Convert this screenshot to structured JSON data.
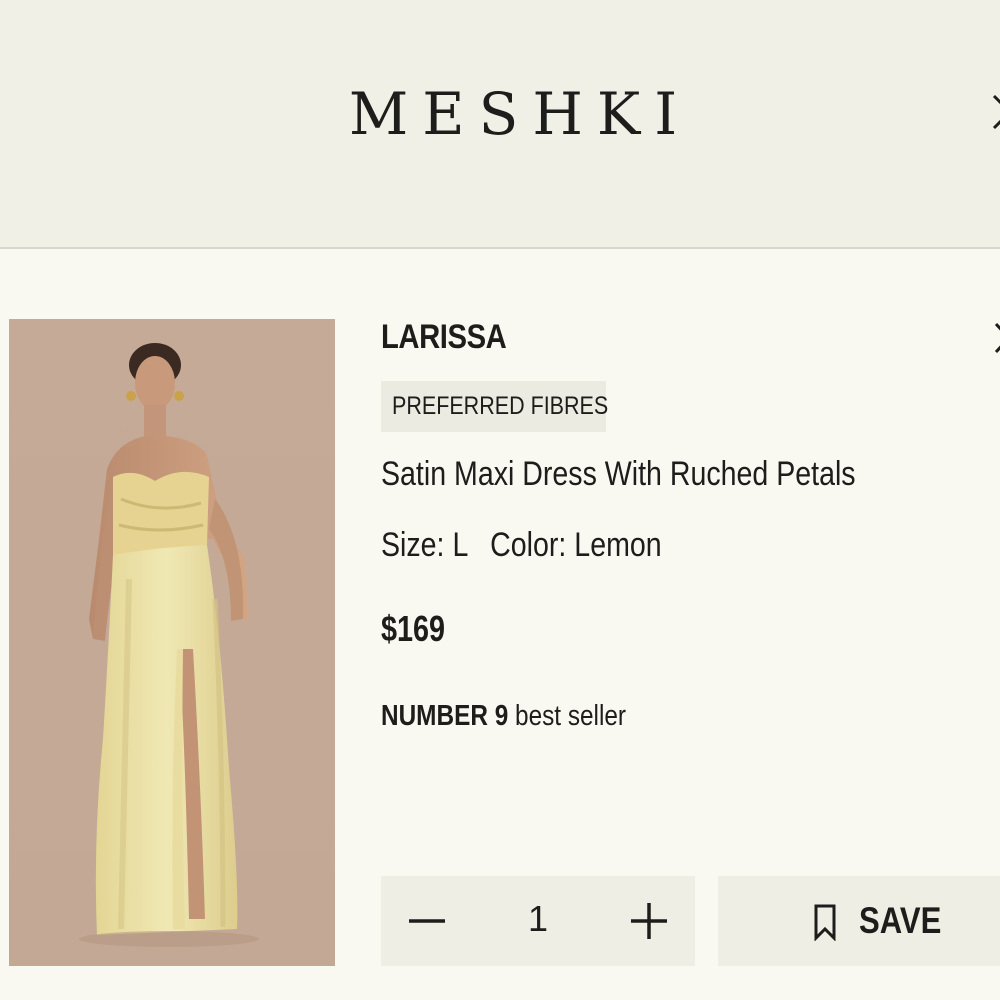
{
  "header": {
    "brand": "MESHKI"
  },
  "product": {
    "name": "LARISSA",
    "badge": "PREFERRED FIBRES",
    "description": "Satin Maxi Dress With Ruched Petals",
    "size_label": "Size:",
    "size_value": "L",
    "color_label": "Color:",
    "color_value": "Lemon",
    "price": "$169",
    "bestseller_prefix": "NUMBER",
    "bestseller_rank": "9",
    "bestseller_suffix": "best seller",
    "image_alt": "Model wearing lemon satin strapless maxi dress"
  },
  "quantity": {
    "value": "1"
  },
  "save": {
    "label": "SAVE"
  },
  "colors": {
    "header_bg": "#f1f0e6",
    "page_bg": "#f9f8f1",
    "control_bg": "#efeee4",
    "text": "#1d1d1b",
    "image_bg": "#c8ad9a",
    "dress": "#ebe2a4"
  },
  "icons": {
    "header_close": "close-icon",
    "item_remove": "close-icon",
    "qty_minus": "minus-icon",
    "qty_plus": "plus-icon",
    "save": "bookmark-icon"
  }
}
